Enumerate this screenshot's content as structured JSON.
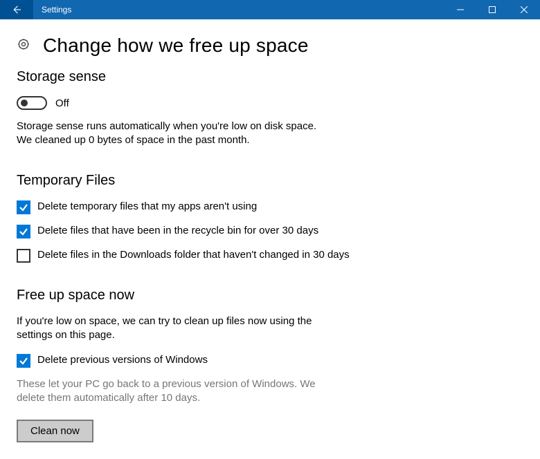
{
  "window": {
    "title": "Settings"
  },
  "page": {
    "title": "Change how we free up space"
  },
  "storage_sense": {
    "heading": "Storage sense",
    "toggle_label": "Off",
    "description_line1": "Storage sense runs automatically when you're low on disk space.",
    "description_line2": "We cleaned up 0 bytes of space in the past month."
  },
  "temporary_files": {
    "heading": "Temporary Files",
    "options": [
      {
        "label": "Delete temporary files that my apps aren't using",
        "checked": true
      },
      {
        "label": "Delete files that have been in the recycle bin for over 30 days",
        "checked": true
      },
      {
        "label": "Delete files in the Downloads folder that haven't changed in 30 days",
        "checked": false
      }
    ]
  },
  "free_up": {
    "heading": "Free up space now",
    "description": "If you're low on space, we can try to clean up files now using the settings on this page.",
    "option_label": "Delete previous versions of Windows",
    "option_checked": true,
    "note": "These let your PC go back to a previous version of Windows. We delete them automatically after 10 days.",
    "button": "Clean now"
  }
}
